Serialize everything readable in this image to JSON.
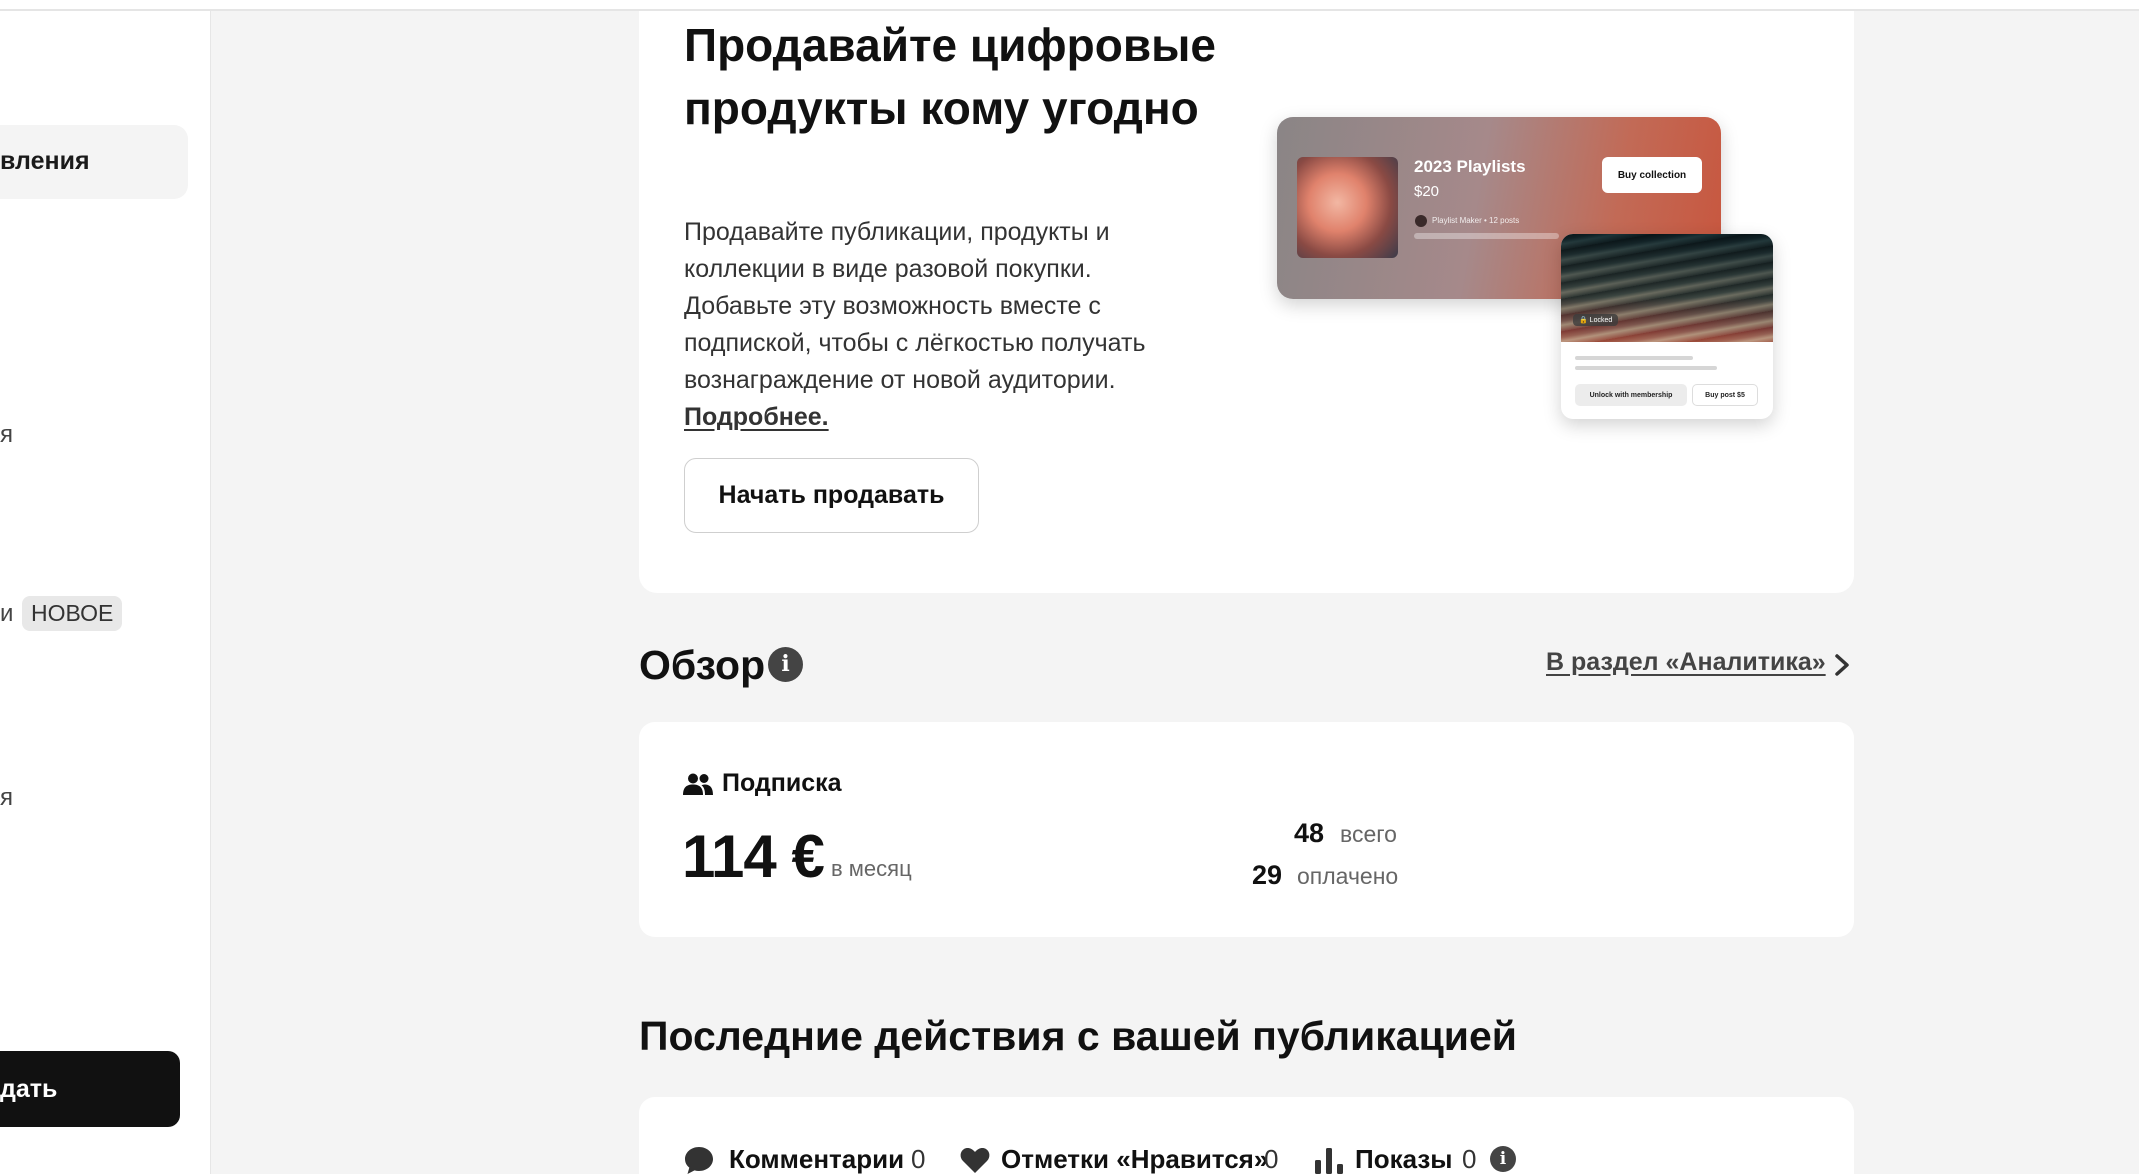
{
  "sidebar": {
    "active_item": "вления",
    "item_partial_1": "я",
    "item_partial_2": "и",
    "new_badge": "НОВОЕ",
    "item_partial_3": "я",
    "primary_button": "дать"
  },
  "promo": {
    "title": "Продавайте цифровые продукты кому угодно",
    "text": "Продавайте публикации, продукты и коллекции в виде разовой покупки. Добавьте эту возможность вместе с подпиской, чтобы с лёгкостью получать вознаграждение от новой аудитории.",
    "link": "Подробнее.",
    "button": "Начать продавать",
    "illustration": {
      "playlist_title": "2023 Playlists",
      "playlist_price": "$20",
      "playlist_meta": "Playlist Maker • 12 posts",
      "buy_collection": "Buy collection",
      "locked": "Locked",
      "unlock_membership": "Unlock with membership",
      "buy_post": "Buy post $5"
    }
  },
  "overview": {
    "title": "Обзор",
    "analytics_link": "В раздел «Аналитика»",
    "subscription_label": "Подписка",
    "amount": "114 €",
    "amount_unit": "в месяц",
    "total_value": "48",
    "total_label": "всего",
    "paid_value": "29",
    "paid_label": "оплачено"
  },
  "activity": {
    "title": "Последние действия с вашей публикацией",
    "comments_label": "Комментарии",
    "comments_value": "0",
    "likes_label": "Отметки «Нравится»",
    "likes_value": "0",
    "views_label": "Показы",
    "views_value": "0"
  },
  "colors": {
    "page_bg": "#f4f4f4",
    "card_bg": "#ffffff",
    "primary_button": "#111111"
  }
}
